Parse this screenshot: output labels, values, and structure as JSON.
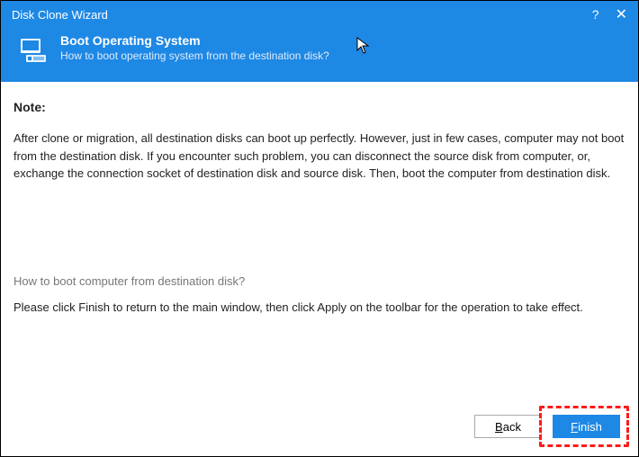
{
  "titlebar": {
    "title": "Disk Clone Wizard",
    "help_label": "?",
    "close_label": "✕"
  },
  "header": {
    "title": "Boot Operating System",
    "subtitle": "How to boot operating system from the destination disk?"
  },
  "content": {
    "note_label": "Note:",
    "note_body": "After clone or migration, all destination disks can boot up perfectly. However, just in few cases, computer may not boot from the destination disk. If you encounter such problem, you can disconnect the source disk from computer, or, exchange the connection socket of destination disk and source disk. Then, boot the computer from destination disk.",
    "link_text": "How to boot computer from destination disk?",
    "instruction": "Please click Finish to return to the main window, then click Apply on the toolbar for the operation to take effect."
  },
  "footer": {
    "back_label": "Back",
    "finish_label": "Finish"
  },
  "colors": {
    "primary": "#1e88e5",
    "highlight": "#ff1a1a"
  }
}
